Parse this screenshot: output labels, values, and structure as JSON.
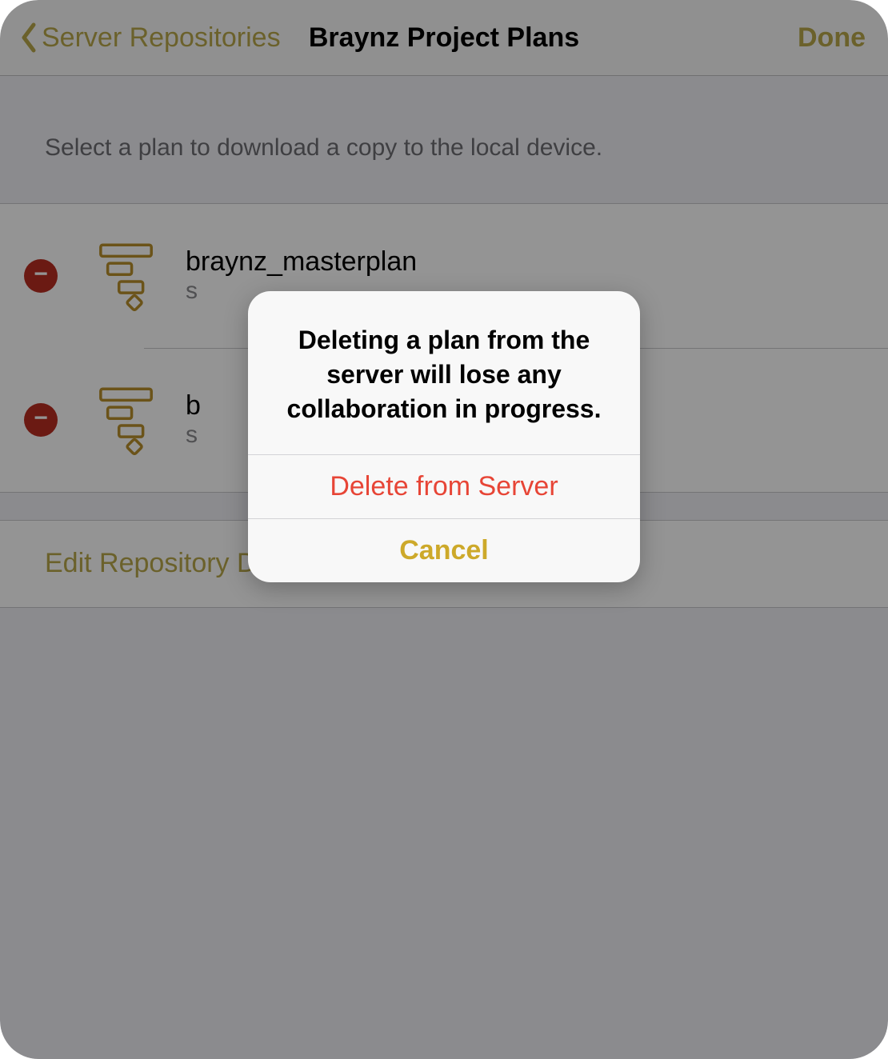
{
  "colors": {
    "accent": "#b8a84a",
    "destructive": "#e74536",
    "deleteDot": "#b92e22"
  },
  "nav": {
    "back_label": "Server Repositories",
    "title": "Braynz Project Plans",
    "done_label": "Done"
  },
  "hint": "Select a plan to download a copy to the local device.",
  "plans": [
    {
      "title": "braynz_masterplan",
      "subtitle_visible": "s"
    },
    {
      "title_visible": "b",
      "subtitle_visible": "s"
    }
  ],
  "edit_row": {
    "label": "Edit Repository Details"
  },
  "alert": {
    "message": "Deleting a plan from the server will lose any collaboration in progress.",
    "delete_label": "Delete from Server",
    "cancel_label": "Cancel"
  }
}
